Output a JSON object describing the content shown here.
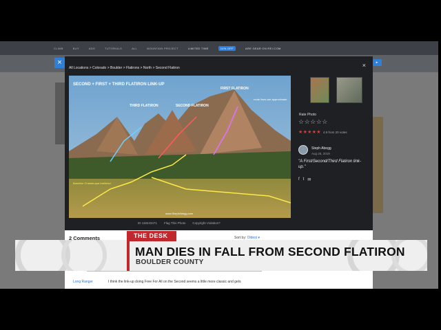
{
  "site_nav": {
    "items": [
      "CLIMB",
      "BUY",
      "ADS",
      "TUTORIALS",
      "ALL",
      "MOUNTAIN PROJECT"
    ],
    "offer": "LIMITED TIME",
    "offer_pill": "14% OFF",
    "offer_tail": "ARE GEAR ON REI.COM"
  },
  "modal": {
    "breadcrumb": "All Locations > Colorado > Boulder > Flatirons > North > Second Flatiron",
    "close": "×",
    "photo": {
      "title": "SECOND + FIRST + THIRD FLATIRON LINK-UP",
      "labels": {
        "first": "FIRST FLATIRON",
        "second": "SECOND FLATIRON",
        "third": "THIRD FLATIRON",
        "note": "route lines are approximate",
        "trail": "Baseline Chautauqua trailhead",
        "watermark": "www.StephAbegg.com"
      }
    },
    "footer": {
      "id": "ID 118243471",
      "flag": "Flag This Photo",
      "copyright": "Copyright Violation?"
    },
    "rate_label": "Rate Photo",
    "empty_stars": "☆☆☆☆☆",
    "filled_stars": "★★★★★",
    "rating_text": "4.9 from 20 votes",
    "author": "Steph Abegg",
    "date": "Aug 26, 2019",
    "caption": "\"A First/Second/Third Flatiron link-up.\"",
    "share_icons": [
      "f",
      "t",
      "✉"
    ]
  },
  "comments": {
    "title": "2 Comments",
    "sort_label": "Sort by:",
    "sort_value": "Oldest ▾",
    "commenter": "Long Ranger",
    "comment_text": "I think the link-up doing Free For All on the Second seems a little more classic and gets"
  },
  "news": {
    "tag": "THE DESK",
    "headline": "MAN DIES IN FALL FROM SECOND FLATIRON",
    "subline": "BOULDER COUNTY"
  },
  "colors": {
    "accent_red": "#c0282d",
    "link_blue": "#2f6fd0",
    "star_red": "#e53935"
  }
}
